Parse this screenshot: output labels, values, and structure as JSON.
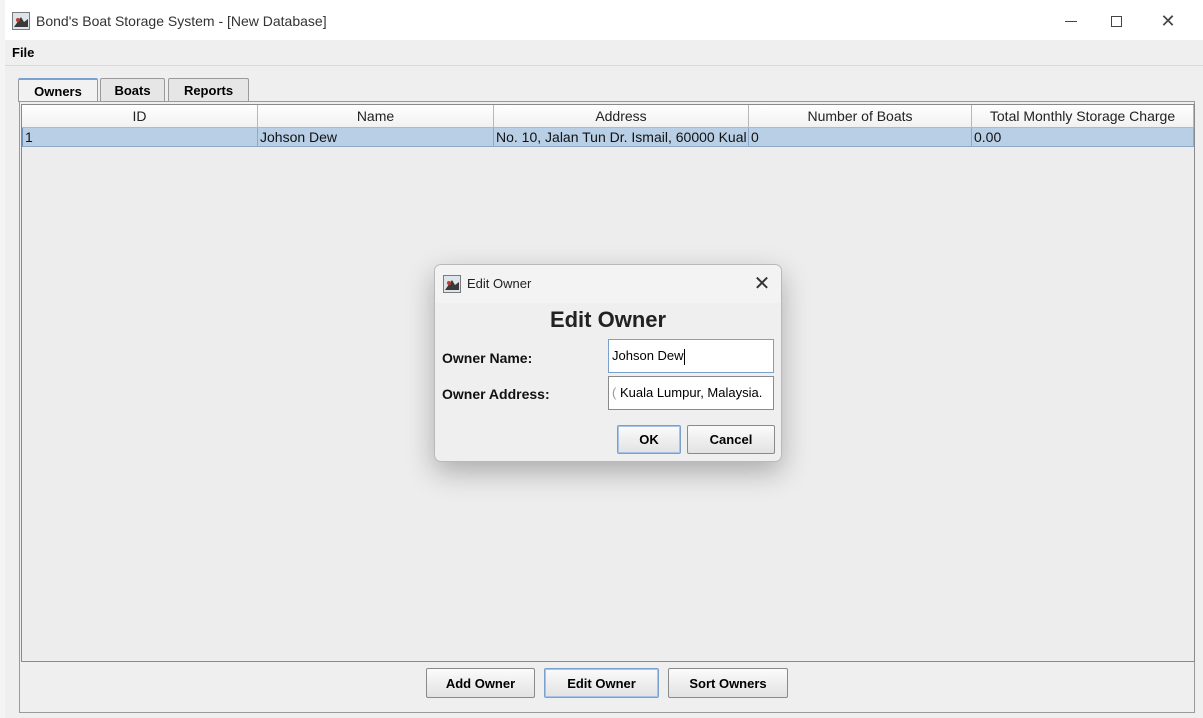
{
  "window": {
    "title": "Bond's Boat Storage System - [New Database]"
  },
  "menu": {
    "file": "File"
  },
  "tabs": [
    {
      "label": "Owners"
    },
    {
      "label": "Boats"
    },
    {
      "label": "Reports"
    }
  ],
  "table": {
    "columns": [
      "ID",
      "Name",
      "Address",
      "Number of Boats",
      "Total Monthly Storage Charge"
    ],
    "rows": [
      [
        "1",
        "Johson Dew",
        "No. 10, Jalan Tun Dr. Ismail, 60000 Kual",
        "0",
        "0.00"
      ]
    ]
  },
  "buttons": {
    "add": "Add Owner",
    "edit": "Edit Owner",
    "sort": "Sort Owners"
  },
  "dialog": {
    "title": "Edit Owner",
    "heading": "Edit Owner",
    "name_label": "Owner Name:",
    "name_value": "Johson Dew",
    "address_label": "Owner Address:",
    "address_value": "Kuala Lumpur, Malaysia.",
    "ok": "OK",
    "cancel": "Cancel"
  },
  "colors": {
    "selection": "#b9cfe6",
    "focus": "#7aa0cf"
  }
}
